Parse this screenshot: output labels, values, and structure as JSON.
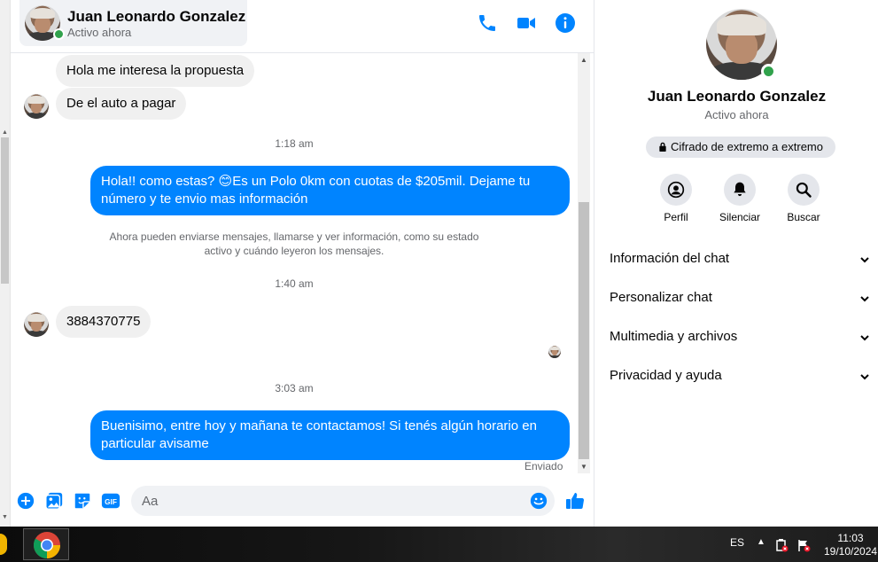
{
  "contact": {
    "name": "Juan Leonardo Gonzalez",
    "status": "Activo ahora"
  },
  "messages": [
    {
      "type": "in",
      "text": "Hola me interesa la propuesta"
    },
    {
      "type": "in",
      "text": "De el auto a pagar"
    },
    {
      "type": "time",
      "text": "1:18 am"
    },
    {
      "type": "out",
      "text": "Hola!! como estas? 😊Es un Polo 0km con cuotas de $205mil. Dejame tu número y te envio mas información"
    },
    {
      "type": "system",
      "text": "Ahora pueden enviarse mensajes, llamarse y ver información, como su estado activo y cuándo leyeron los mensajes."
    },
    {
      "type": "time",
      "text": "1:40 am"
    },
    {
      "type": "in",
      "text": "3884370775"
    },
    {
      "type": "time",
      "text": "3:03 am"
    },
    {
      "type": "out",
      "text": "Buenisimo, entre hoy y mañana te contactamos! Si tenés algún horario en particular avisame"
    }
  ],
  "sent_status": "Enviado",
  "composer": {
    "placeholder": "Aa",
    "value": ""
  },
  "info_panel": {
    "encryption": "Cifrado de extremo a extremo",
    "actions": [
      "Perfil",
      "Silenciar",
      "Buscar"
    ],
    "sections": [
      "Información del chat",
      "Personalizar chat",
      "Multimedia y archivos",
      "Privacidad y ayuda"
    ]
  },
  "taskbar": {
    "language": "ES",
    "time": "11:03",
    "date": "19/10/2024"
  },
  "colors": {
    "accent": "#0084ff",
    "online": "#31a24c",
    "incoming_bubble": "#f0f0f0"
  }
}
